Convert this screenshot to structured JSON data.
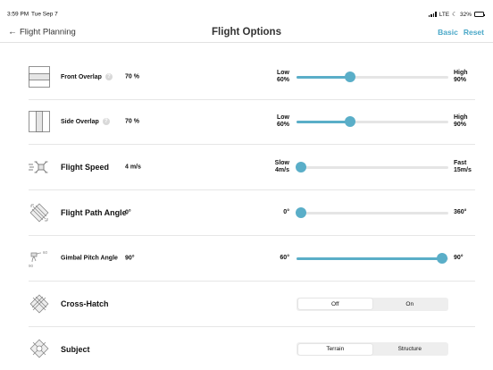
{
  "status": {
    "time": "3:59 PM",
    "date": "Tue Sep 7",
    "network": "LTE",
    "battery": "32%",
    "battery_level": 0.32
  },
  "nav": {
    "back_label": "Flight Planning",
    "title": "Flight Options",
    "basic_label": "Basic",
    "reset_label": "Reset"
  },
  "settings": {
    "front_overlap": {
      "label": "Front Overlap",
      "help": "?",
      "value": "70 %",
      "min_label": "Low",
      "min_value": "60%",
      "max_label": "High",
      "max_value": "90%",
      "level": 0.35,
      "icon": "front-overlap-icon"
    },
    "side_overlap": {
      "label": "Side Overlap",
      "help": "?",
      "value": "70 %",
      "min_label": "Low",
      "min_value": "60%",
      "max_label": "High",
      "max_value": "90%",
      "level": 0.35,
      "icon": "side-overlap-icon"
    },
    "flight_speed": {
      "label": "Flight Speed",
      "value": "4 m/s",
      "min_label": "Slow",
      "min_value": "4m/s",
      "max_label": "Fast",
      "max_value": "15m/s",
      "level": 0.03,
      "icon": "drone-speed-icon"
    },
    "flight_path_angle": {
      "label": "Flight Path Angle",
      "value": "0°",
      "min_label": "0°",
      "max_label": "360°",
      "level": 0.03,
      "icon": "flight-path-angle-icon"
    },
    "gimbal_pitch_angle": {
      "label": "Gimbal Pitch Angle",
      "value": "90°",
      "min_label": "60°",
      "max_label": "90°",
      "level": 0.96,
      "icon": "gimbal-pitch-icon",
      "icon_labels": [
        "60",
        "90"
      ]
    },
    "cross_hatch": {
      "label": "Cross-Hatch",
      "options": [
        "Off",
        "On"
      ],
      "selected": "Off",
      "icon": "cross-hatch-icon"
    },
    "subject": {
      "label": "Subject",
      "options": [
        "Terrain",
        "Structure"
      ],
      "selected": "Terrain",
      "icon": "subject-icon"
    }
  },
  "colors": {
    "accent": "#5aaec8",
    "nav_action": "#4aa8c8",
    "track": "#e5e5e5"
  }
}
